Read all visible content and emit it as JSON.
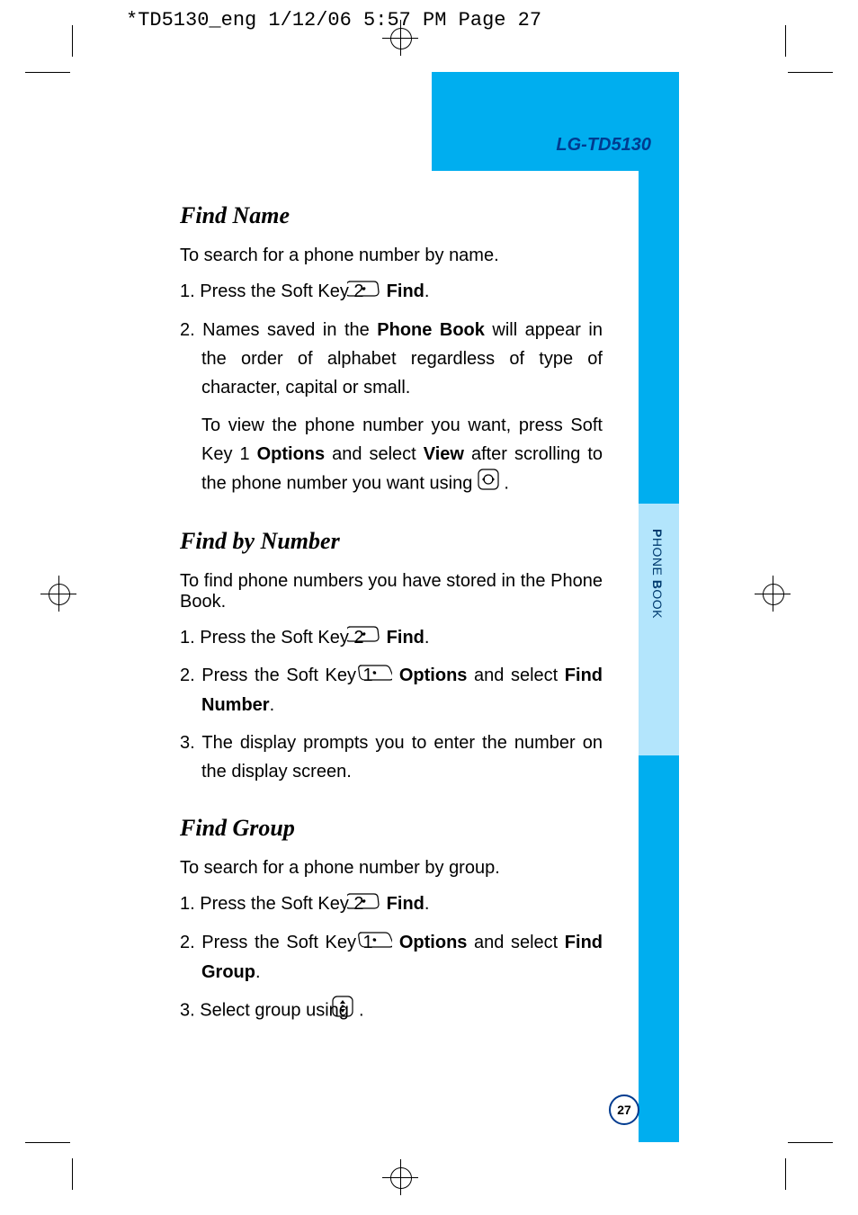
{
  "header": "*TD5130_eng  1/12/06  5:57 PM  Page 27",
  "model": "LG-TD5130",
  "tab": "PHONE BOOK",
  "page_num": "27",
  "sections": [
    {
      "title": "Find Name",
      "intro": "To search for a phone number by name.",
      "steps": [
        {
          "pre": "1. Press the Soft Key 2 ",
          "icon": "softkey-right",
          "post": " ",
          "bold1": "Find",
          "after": "."
        },
        {
          "text": "2. Names saved in the ",
          "bold1": "Phone Book",
          "after": " will appear in the order of alphabet regardless of type of character, capital or small."
        }
      ],
      "extra": {
        "pre": "To view the phone number you want, press Soft Key 1 ",
        "bold1": "Options",
        "mid": " and select ",
        "bold2": "View",
        "after": " after scrolling to the phone number you want using ",
        "icon": "nav-lr",
        "tail": " ."
      }
    },
    {
      "title": "Find by Number",
      "intro": "To find phone numbers you have stored in the Phone Book.",
      "steps": [
        {
          "pre": "1. Press the Soft Key 2 ",
          "icon": "softkey-right",
          "post": " ",
          "bold1": "Find",
          "after": "."
        },
        {
          "pre": "2. Press the Soft Key 1 ",
          "icon": "softkey-left",
          "post": " ",
          "bold1": "Options",
          "mid": " and select ",
          "bold2": "Find Number",
          "after": "."
        },
        {
          "text": "3. The display prompts you to enter the number on the display screen."
        }
      ]
    },
    {
      "title": "Find Group",
      "intro": "To search for a phone number by group.",
      "steps": [
        {
          "pre": "1. Press the Soft Key 2 ",
          "icon": "softkey-right",
          "post": " ",
          "bold1": "Find",
          "after": "."
        },
        {
          "pre": "2. Press the Soft Key 1 ",
          "icon": "softkey-left",
          "post": " ",
          "bold1": "Options",
          "mid": " and select ",
          "bold2": "Find Group",
          "after": "."
        },
        {
          "pre": "3. Select group using ",
          "icon": "nav-ud",
          "after": " ."
        }
      ]
    }
  ]
}
